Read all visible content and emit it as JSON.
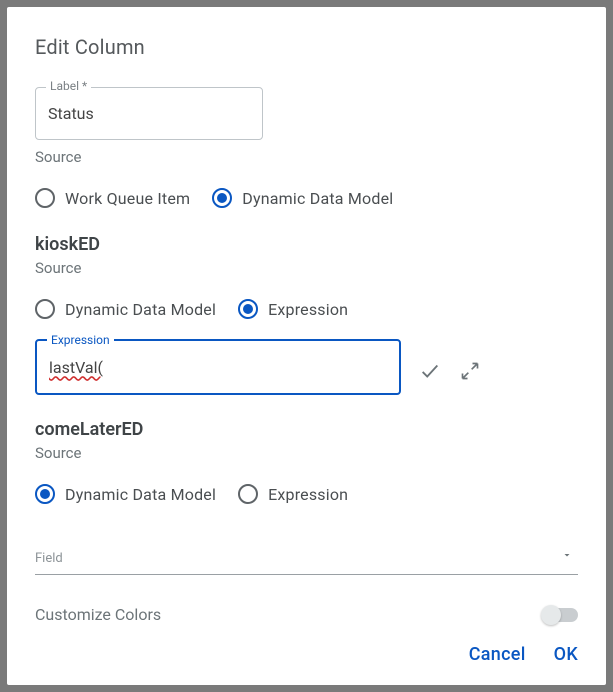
{
  "dialog": {
    "title": "Edit Column",
    "label_field": {
      "label": "Label *",
      "value": "Status"
    },
    "section1": {
      "source_label": "Source",
      "radios": {
        "work_queue": "Work Queue Item",
        "dynamic": "Dynamic Data Model"
      }
    },
    "section2": {
      "heading": "kioskED",
      "source_label": "Source",
      "radios": {
        "dynamic": "Dynamic Data Model",
        "expression": "Expression"
      },
      "expression_field": {
        "label": "Expression",
        "value": "lastVal("
      }
    },
    "section3": {
      "heading": "comeLaterED",
      "source_label": "Source",
      "radios": {
        "dynamic": "Dynamic Data Model",
        "expression": "Expression"
      }
    },
    "field_select": {
      "label": "Field"
    },
    "customize_colors": "Customize Colors",
    "footer": {
      "cancel": "Cancel",
      "ok": "OK"
    }
  }
}
